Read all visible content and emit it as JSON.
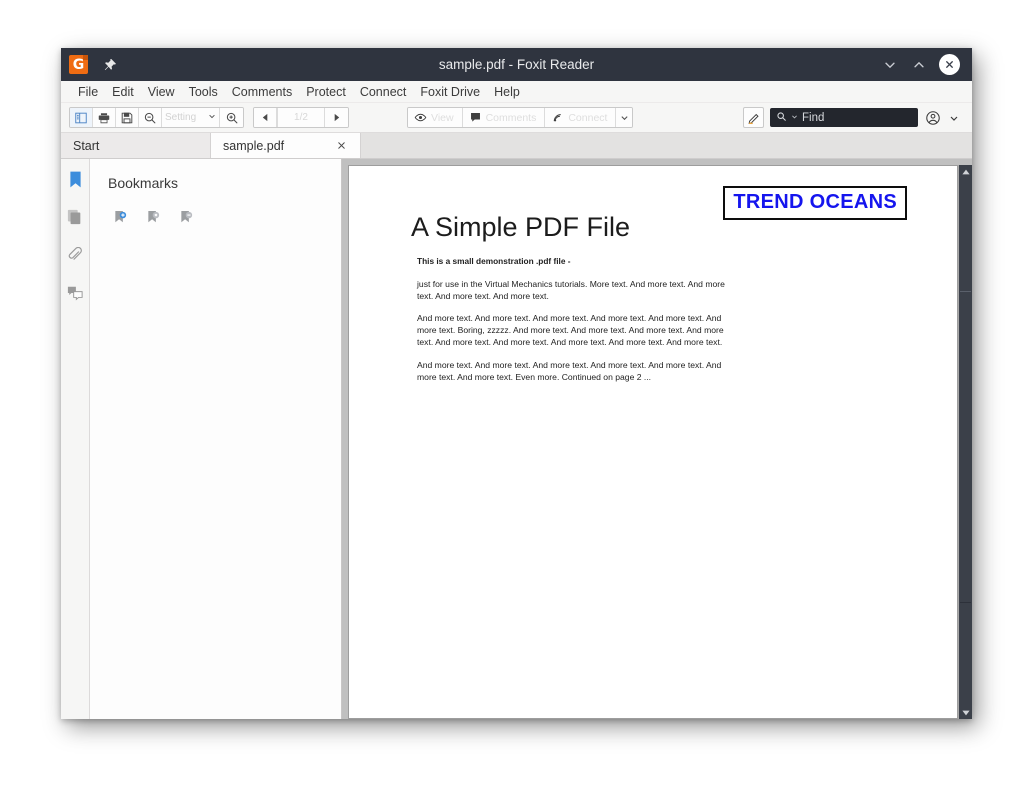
{
  "window": {
    "title": "sample.pdf - Foxit Reader",
    "app_icon": "foxit-logo-icon",
    "pin_icon": "pushpin-icon",
    "controls": {
      "minimize_label": "⌄",
      "maximize_label": "⌃",
      "close_label": "✕"
    }
  },
  "menubar": {
    "items": [
      {
        "label": "File"
      },
      {
        "label": "Edit"
      },
      {
        "label": "View"
      },
      {
        "label": "Tools"
      },
      {
        "label": "Comments"
      },
      {
        "label": "Protect"
      },
      {
        "label": "Connect"
      },
      {
        "label": "Foxit Drive"
      },
      {
        "label": "Help"
      }
    ]
  },
  "toolbar": {
    "sidebar_toggle_icon": "sidebar-panel-icon",
    "print_icon": "printer-icon",
    "save_icon": "save-floppy-icon",
    "zoom_out_icon": "zoom-out-icon",
    "zoom_in_icon": "zoom-in-icon",
    "zoom_value": "",
    "zoom_placeholder": "Setting",
    "page_prev_icon": "triangle-left-icon",
    "page_next_icon": "triangle-right-icon",
    "page_indicator": "1/2",
    "mode_buttons": [
      {
        "label": "View",
        "icon": "eye-icon"
      },
      {
        "label": "Comments",
        "icon": "comment-bubble-icon"
      },
      {
        "label": "Connect",
        "icon": "connect-signal-icon"
      }
    ],
    "mode_caret_icon": "chevron-down-icon",
    "pen_icon": "highlighter-pen-icon",
    "find": {
      "search_icon": "search-icon",
      "dropdown_icon": "chevron-down-icon",
      "placeholder": "Find",
      "value": "Find"
    },
    "account_icon": "account-circle-icon",
    "account_caret_icon": "chevron-down-icon"
  },
  "tabbar": {
    "tabs": [
      {
        "label": "Start",
        "active": false,
        "closable": false
      },
      {
        "label": "sample.pdf",
        "active": true,
        "closable": true
      }
    ],
    "close_label": "✕"
  },
  "rail": {
    "items": [
      {
        "name": "bookmarks",
        "icon": "bookmark-icon",
        "active": true
      },
      {
        "name": "pages",
        "icon": "page-thumbnails-icon",
        "active": false
      },
      {
        "name": "attachments",
        "icon": "paperclip-icon",
        "active": false
      },
      {
        "name": "comments",
        "icon": "comments-list-icon",
        "active": false
      }
    ]
  },
  "bookmarks_panel": {
    "title": "Bookmarks",
    "actions": [
      {
        "name": "new-bookmark",
        "icon": "bookmark-add-icon"
      },
      {
        "name": "delete-bookmark",
        "icon": "bookmark-delete-icon"
      },
      {
        "name": "collapse-bookmark",
        "icon": "bookmark-collapse-icon"
      }
    ]
  },
  "document": {
    "badge_text": "TREND OCEANS",
    "badge_color": "#1515ee",
    "title": "A Simple PDF File",
    "paragraphs": [
      "This is a small demonstration .pdf file -",
      "just for use in the Virtual Mechanics tutorials. More text. And more text. And more text. And more text. And more text.",
      "And more text. And more text. And more text. And more text. And more text. And more text. Boring, zzzzz. And more text. And more text. And more text. And more text. And more text. And more text. And more text. And more text. And more text.",
      "And more text. And more text. And more text. And more text. And more text. And more text. And more text. Even more. Continued on page 2 ..."
    ]
  },
  "scrollbar": {
    "up_arrow_icon": "triangle-up-icon",
    "down_arrow_icon": "triangle-down-icon"
  }
}
